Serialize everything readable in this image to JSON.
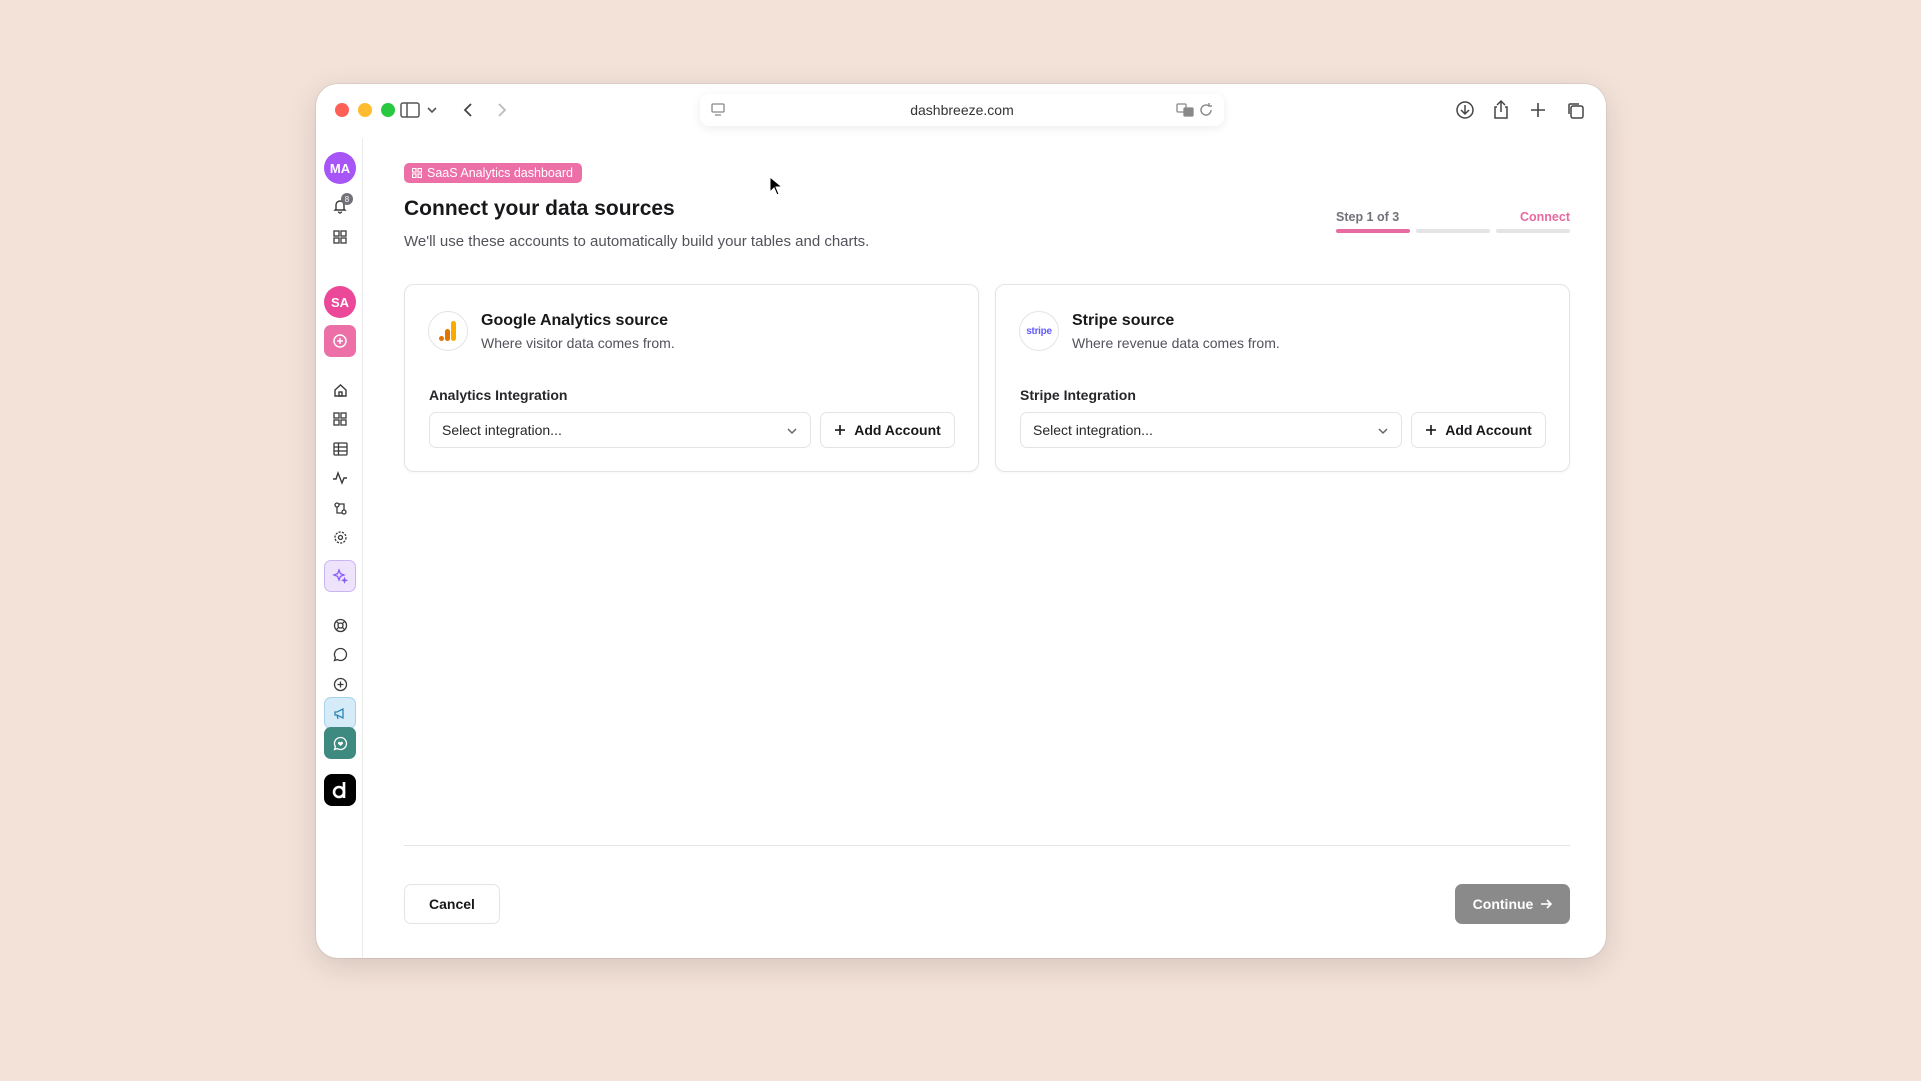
{
  "browser": {
    "url": "dashbreeze.com"
  },
  "sidebar": {
    "user_initials": "MA",
    "notification_count": "8",
    "workspace_initials": "SA",
    "colors": {
      "user_avatar": "#a855f7",
      "workspace_avatar": "#ec4899",
      "add_button": "#ec6fa8",
      "ai_button_bg": "#ede4fb",
      "announce_bg": "#d5ecf8",
      "support_bg": "#3f8a80"
    },
    "items": [
      {
        "name": "home-icon"
      },
      {
        "name": "dashboards-icon"
      },
      {
        "name": "tables-icon"
      },
      {
        "name": "activity-icon"
      },
      {
        "name": "integrations-icon"
      },
      {
        "name": "settings-icon"
      },
      {
        "name": "ai-sparkle-icon"
      },
      {
        "name": "help-icon"
      },
      {
        "name": "chat-icon"
      },
      {
        "name": "add-circle-icon"
      },
      {
        "name": "megaphone-icon"
      },
      {
        "name": "heart-chat-icon"
      },
      {
        "name": "app-logo-icon"
      }
    ]
  },
  "header": {
    "tag_label": "SaaS Analytics dashboard",
    "title": "Connect your data sources",
    "subtitle": "We'll use these accounts to automatically build your tables and charts."
  },
  "steps": {
    "label": "Step 1 of 3",
    "current": "Connect",
    "progress": 0.33,
    "accent": "#e86aa3"
  },
  "cards": [
    {
      "title": "Google Analytics source",
      "description": "Where visitor data comes from.",
      "field_label": "Analytics Integration",
      "select_placeholder": "Select integration...",
      "add_label": "Add Account"
    },
    {
      "title": "Stripe source",
      "description": "Where revenue data comes from.",
      "field_label": "Stripe Integration",
      "select_placeholder": "Select integration...",
      "add_label": "Add Account",
      "logo_text": "stripe"
    }
  ],
  "footer": {
    "cancel_label": "Cancel",
    "continue_label": "Continue"
  }
}
